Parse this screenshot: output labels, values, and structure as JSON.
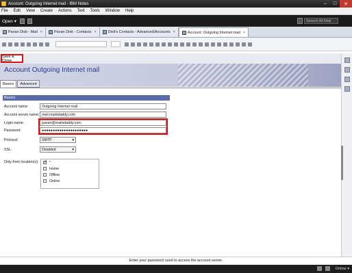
{
  "window": {
    "title": "Account: Outgoing Internet mail - IBM Notes"
  },
  "menu": [
    "File",
    "Edit",
    "View",
    "Create",
    "Actions",
    "Text",
    "Tools",
    "Window",
    "Help"
  ],
  "topbar": {
    "open_label": "Open ▾",
    "search_placeholder": "Search All Mail"
  },
  "tabs": [
    {
      "label": "Pavan Dixit - Mail"
    },
    {
      "label": "Pavan Dixit - Contacts"
    },
    {
      "label": "Dixit's Contacts - Advanced\\Accounts"
    },
    {
      "label": "Account: Outgoing Internet mail"
    }
  ],
  "actionbar": {
    "save_close": "Save & Close"
  },
  "banner": {
    "title_first": "Account",
    "title_rest": " Outgoing Internet mail"
  },
  "form_tabs": [
    "Basics",
    "Advanced"
  ],
  "section": "Basics",
  "form": {
    "account_name_label": "Account name:",
    "account_name": "Outgoing Internet mail",
    "server_label": "Account server name:",
    "server": "mail.mailsdaddy.com",
    "login_label": "Login name:",
    "login": "pavan@mailsdaddy.com",
    "password_label": "Password:",
    "password": "●●●●●●●●●●●●●●●●●●●●●",
    "protocol_label": "Protocol:",
    "protocol": "SMTP",
    "ssl_label": "SSL:",
    "ssl": "Disabled",
    "location_label": "Only from location(s):",
    "locations": [
      {
        "label": "*",
        "checked": true
      },
      {
        "label": "Home",
        "checked": false
      },
      {
        "label": "Offline",
        "checked": false
      },
      {
        "label": "Online",
        "checked": false
      }
    ]
  },
  "hint": "Enter your password used to access the account server.",
  "status": {
    "online": "Online ▾"
  }
}
